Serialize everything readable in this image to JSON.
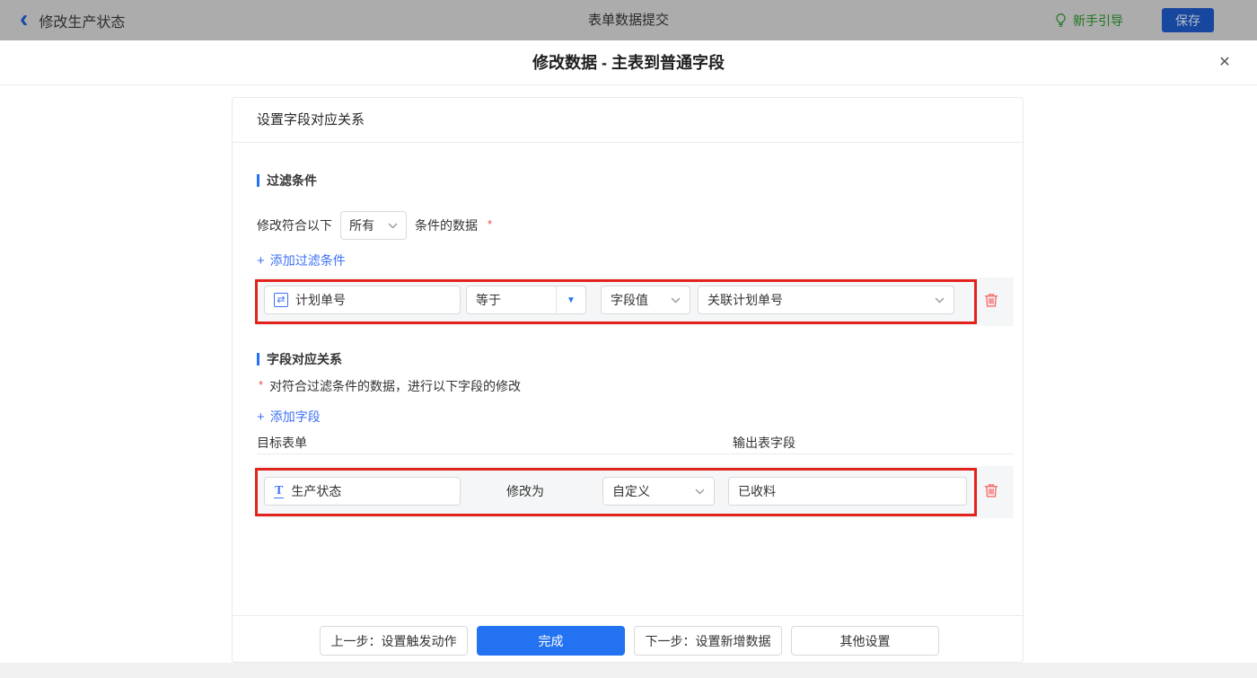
{
  "icons": {
    "back": "‹",
    "close": "✕",
    "plus": "+",
    "dropdown_triangle": "▼",
    "serial_field": "⇄",
    "text_field": "T"
  },
  "topbar": {
    "back_label": "修改生产状态",
    "center_title": "表单数据提交",
    "guide_label": "新手引导",
    "save_label": "保存"
  },
  "dialog": {
    "title": "修改数据 - 主表到普通字段"
  },
  "panel": {
    "header": "设置字段对应关系",
    "filter": {
      "section_title": "过滤条件",
      "condition_prefix": "修改符合以下",
      "match_mode": "所有",
      "condition_suffix": "条件的数据",
      "required_mark": "*",
      "add_label": "添加过滤条件",
      "row": {
        "field": "计划单号",
        "operator": "等于",
        "value_type": "字段值",
        "value_field": "关联计划单号"
      }
    },
    "mapping": {
      "section_title": "字段对应关系",
      "required_mark": "*",
      "note": "对符合过滤条件的数据，进行以下字段的修改",
      "add_label": "添加字段",
      "col_target": "目标表单",
      "col_output": "输出表字段",
      "row": {
        "field": "生产状态",
        "modify_label": "修改为",
        "mode": "自定义",
        "value": "已收料"
      }
    },
    "footer": {
      "prev_label": "上一步：设置触发动作",
      "done_label": "完成",
      "next_label": "下一步：设置新增数据",
      "other_label": "其他设置"
    }
  },
  "colors": {
    "accent_blue": "#2272F2",
    "link_blue": "#3D70F5",
    "annotation_red": "#E2231C",
    "danger_red": "#F56C6C",
    "guide_green": "#1E751E",
    "topbar_bg": "#ACACAC",
    "save_button_blue": "#17479E"
  }
}
